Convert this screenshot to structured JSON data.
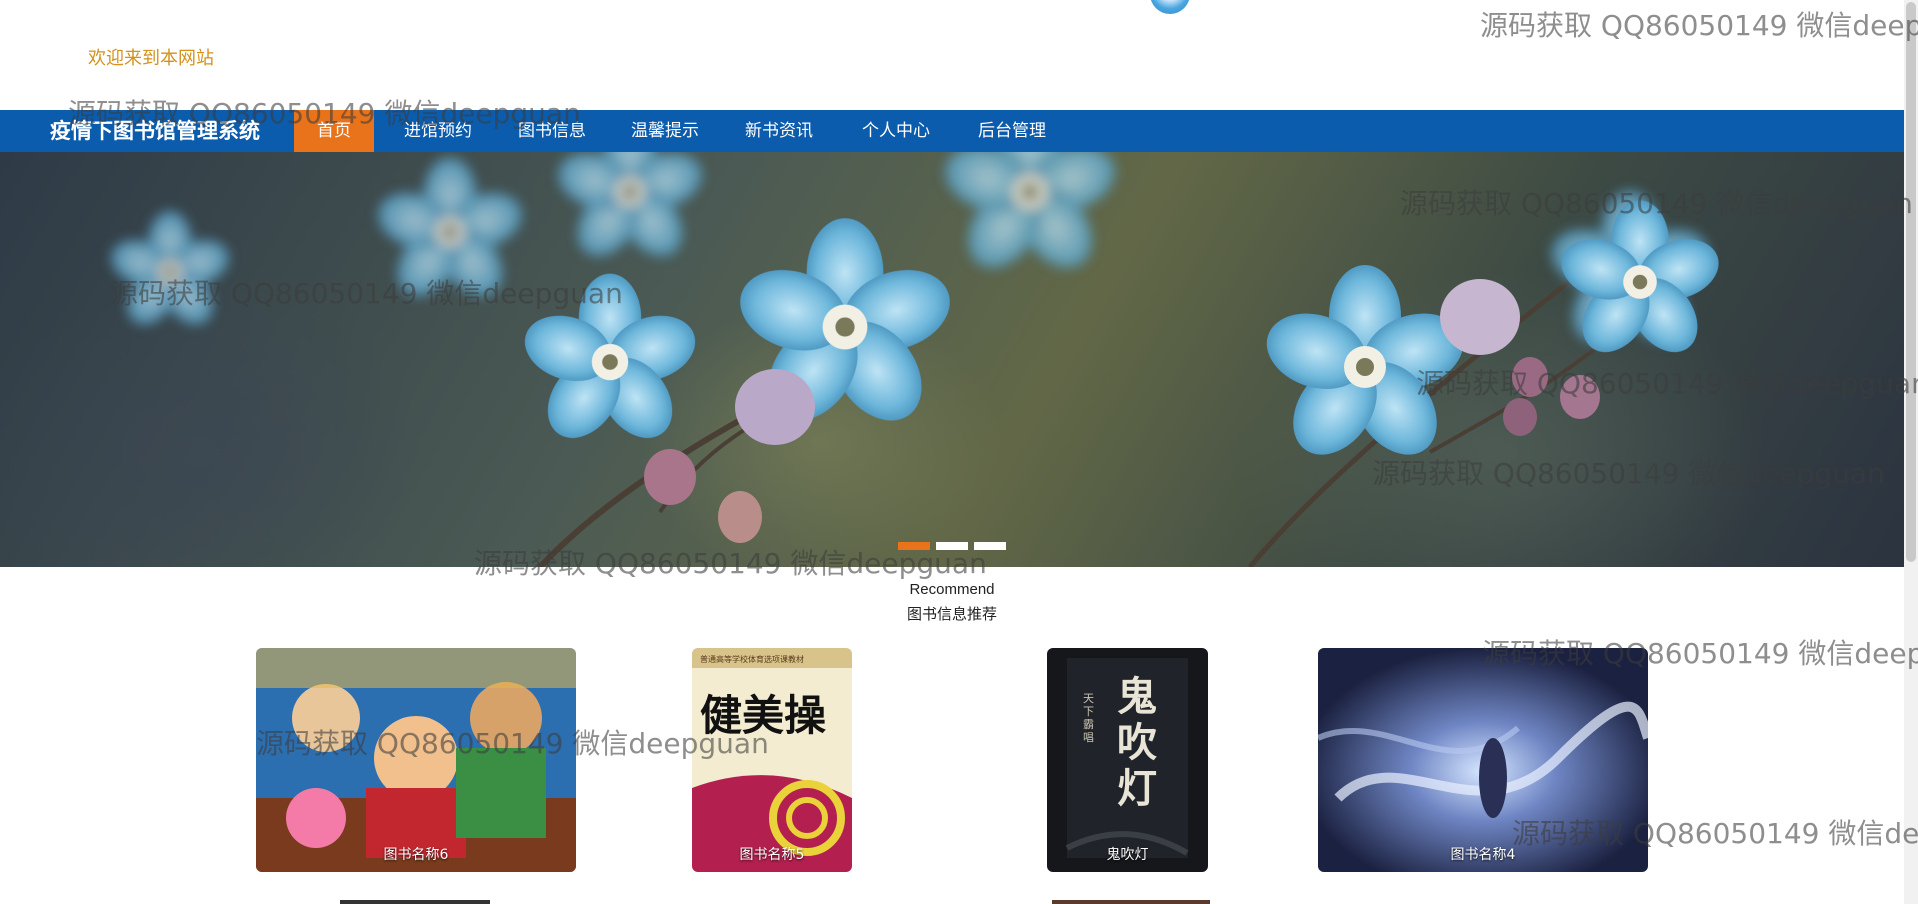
{
  "header": {
    "welcome": "欢迎来到本网站"
  },
  "navbar": {
    "brand": "疫情下图书馆管理系统",
    "items": [
      "首页",
      "进馆预约",
      "图书信息",
      "温馨提示",
      "新书资讯",
      "个人中心",
      "后台管理"
    ],
    "active_index": 0,
    "color": "#0b5cad",
    "active_color": "#e8731a"
  },
  "carousel": {
    "slide_count": 3,
    "active_index": 0
  },
  "section": {
    "title_en": "Recommend",
    "title_cn": "图书信息推荐"
  },
  "books": [
    {
      "name": "图书名称6",
      "cover_icon": "anime-crew-cover"
    },
    {
      "name": "图书名称5",
      "cover_icon": "fitness-book-cover"
    },
    {
      "name": "鬼吹灯",
      "cover_icon": "dark-novel-cover"
    },
    {
      "name": "图书名称4",
      "cover_icon": "fantasy-art-cover"
    }
  ],
  "covers": {
    "fitness_title": "健美操",
    "fitness_subtitle": "普通高等学校体育选项课教材",
    "novel_title": "鬼吹灯",
    "novel_side": "天下霸唱"
  },
  "watermark": "源码获取 QQ86050149 微信deepguan"
}
